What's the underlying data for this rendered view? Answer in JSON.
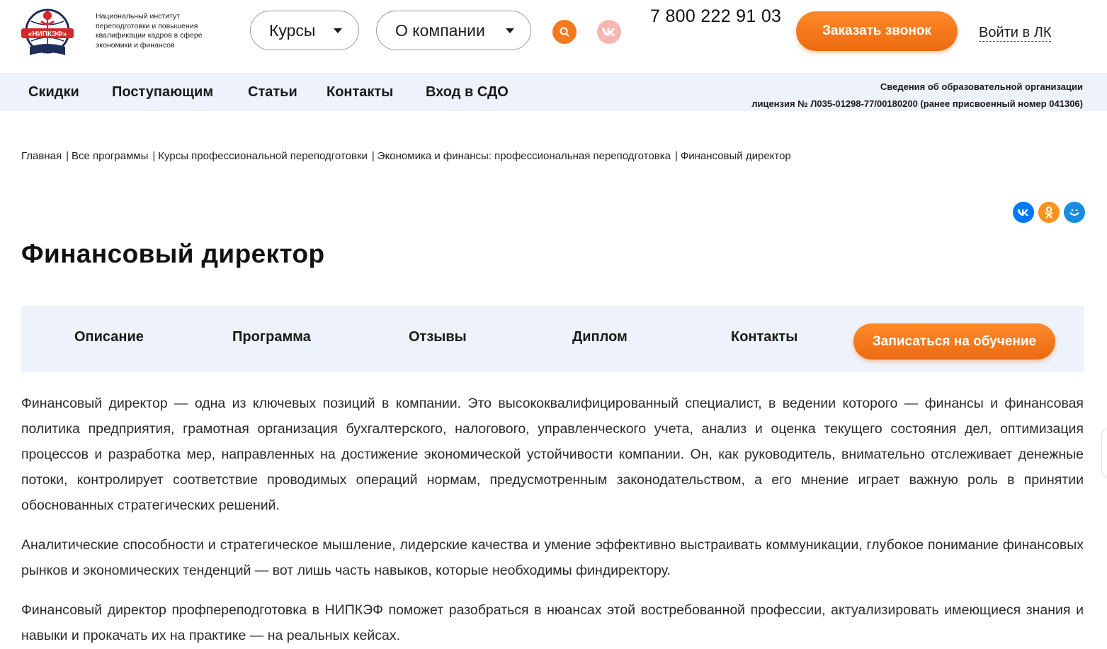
{
  "header": {
    "logo_text": "«НИПКЭФ»",
    "logo_description": "Национальный институт переподготовки и повышения квалификации кадров в сфере экономики и финансов",
    "menu_courses": "Курсы",
    "menu_company": "О компании",
    "phone": "7 800 222 91 03",
    "callback_label": "Заказать звонок",
    "login_label": "Войти в ЛК"
  },
  "subnav": {
    "items": [
      "Скидки",
      "Поступающим",
      "Статьи",
      "Контакты",
      "Вход в СДО"
    ],
    "org_info": "Сведения об образовательной организации",
    "license": "лицензия № Л035-01298-77/00180200 (ранее присвоенный номер 041306)"
  },
  "breadcrumb": [
    "Главная",
    "Все программы",
    "Курсы профессиональной переподготовки",
    "Экономика и финансы: профессиональная переподготовка",
    "Финансовый директор"
  ],
  "page": {
    "title": "Финансовый директор"
  },
  "tabs": {
    "items": [
      "Описание",
      "Программа",
      "Отзывы",
      "Диплом",
      "Контакты"
    ],
    "enroll_label": "Записаться на обучение"
  },
  "content": {
    "paragraphs": [
      "Финансовый директор — одна из ключевых позиций в компании. Это высококвалифицированный специалист, в ведении которого — финансы и финансовая политика предприятия, грамотная организация бухгалтерского, налогового, управленческого учета, анализ и оценка текущего состояния дел, оптимизация процессов и разработка мер, направленных на достижение экономической устойчивости компании. Он, как руководитель, внимательно отслеживает денежные потоки, контролирует соответствие проводимых операций нормам, предусмотренным законодательством, а его мнение играет важную роль в принятии обоснованных стратегических решений.",
      "Аналитические способности и стратегическое мышление, лидерские качества и умение эффективно выстраивать коммуникации, глубокое понимание финансовых рынков и экономических тенденций — вот лишь часть навыков, которые необходимы финдиректору.",
      "Финансовый директор профпереподготовка в НИПКЭФ поможет разобраться в нюансах этой востребованной профессии, актуализировать имеющиеся знания и навыки и прокачать их на практике — на реальных кейсах."
    ]
  },
  "icons": {
    "search": "search-icon",
    "vk_header": "vk-icon",
    "share": [
      "vk-share-icon",
      "odnoklassniki-share-icon",
      "moimir-share-icon"
    ]
  },
  "colors": {
    "accent": "#f37a1f",
    "nav_bg": "#eef2fa",
    "vk_blue": "#0077ff",
    "ok_orange": "#f7931e",
    "mymir_blue": "#168de2",
    "logo_red": "#d22a2a",
    "logo_navy": "#1f2d5c"
  }
}
